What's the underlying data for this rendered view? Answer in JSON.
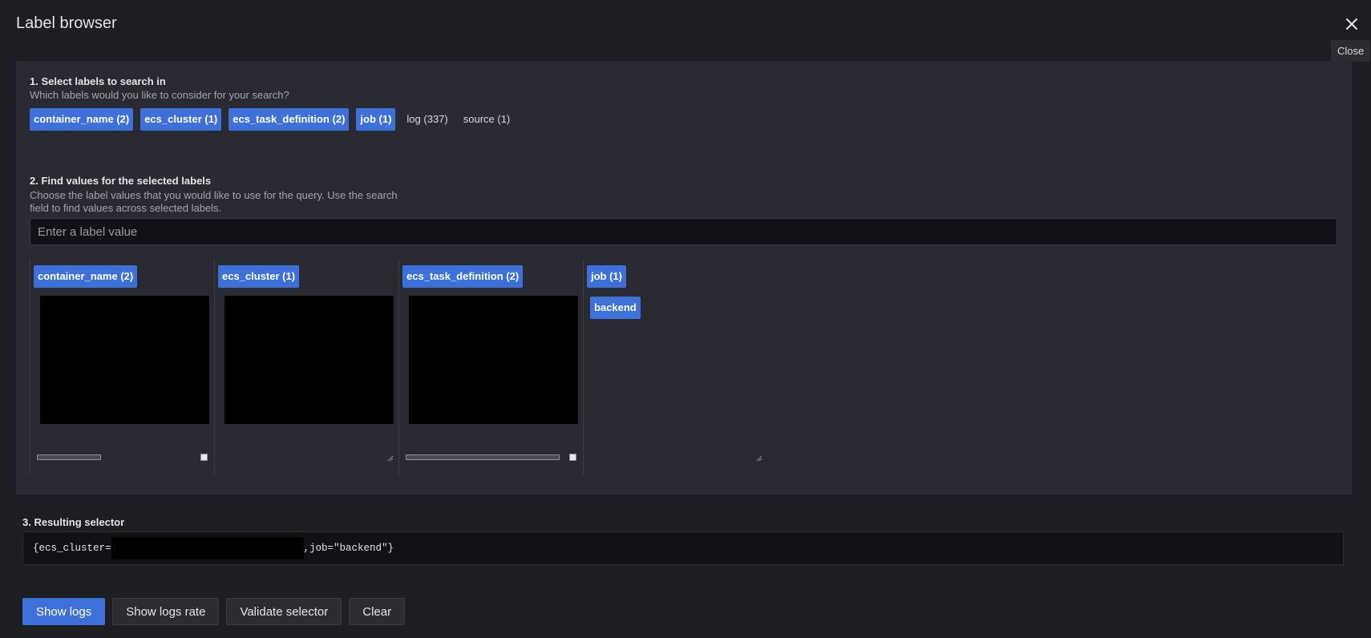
{
  "modal": {
    "title": "Label browser",
    "close_tooltip": "Close"
  },
  "step1": {
    "title": "1. Select labels to search in",
    "description": "Which labels would you like to consider for your search?",
    "labels": [
      {
        "text": "container_name (2)",
        "selected": true
      },
      {
        "text": "ecs_cluster (1)",
        "selected": true
      },
      {
        "text": "ecs_task_definition (2)",
        "selected": true
      },
      {
        "text": "job (1)",
        "selected": true
      },
      {
        "text": "log (337)",
        "selected": false
      },
      {
        "text": "source (1)",
        "selected": false
      }
    ]
  },
  "step2": {
    "title": "2. Find values for the selected labels",
    "description_line1": "Choose the label values that you would like to use for the query. Use the search",
    "description_line2": "field to find values across selected labels.",
    "search_placeholder": "Enter a label value",
    "columns": [
      {
        "label": "container_name (2)"
      },
      {
        "label": "ecs_cluster (1)"
      },
      {
        "label": "ecs_task_definition (2)"
      },
      {
        "label": "job (1)",
        "values": [
          "backend"
        ]
      }
    ]
  },
  "step3": {
    "title": "3. Resulting selector",
    "selector_prefix": "{ecs_cluster=",
    "selector_suffix": ",job=\"backend\"}"
  },
  "buttons": {
    "show_logs": "Show logs",
    "show_logs_rate": "Show logs rate",
    "validate_selector": "Validate selector",
    "clear": "Clear"
  },
  "colors": {
    "accent": "#3d71d9",
    "background": "#1d1e23",
    "panel": "#2a2b32"
  }
}
